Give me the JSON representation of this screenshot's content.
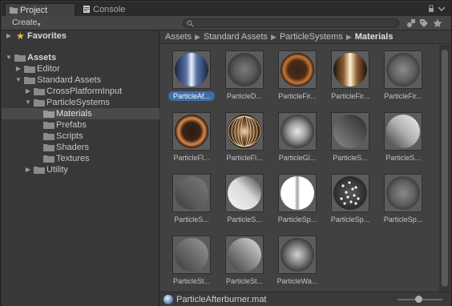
{
  "tabs": [
    {
      "label": "Project",
      "icon": "project-icon",
      "active": true
    },
    {
      "label": "Console",
      "icon": "console-icon",
      "active": false
    }
  ],
  "toolbar": {
    "create_label": "Create",
    "search_value": ""
  },
  "tree": {
    "favorites": "Favorites",
    "assets": "Assets",
    "editor": "Editor",
    "standard_assets": "Standard Assets",
    "cross_platform_input": "CrossPlatformInput",
    "particle_systems": "ParticleSystems",
    "materials": "Materials",
    "prefabs": "Prefabs",
    "scripts": "Scripts",
    "shaders": "Shaders",
    "textures": "Textures",
    "utility": "Utility"
  },
  "breadcrumb": [
    "Assets",
    "Standard Assets",
    "ParticleSystems",
    "Materials"
  ],
  "materials": [
    {
      "name": "ParticleAf...",
      "style": "afterburner",
      "selected": true
    },
    {
      "name": "ParticleD...",
      "style": "dust"
    },
    {
      "name": "ParticleFir...",
      "style": "fire-ring"
    },
    {
      "name": "ParticleFir...",
      "style": "fire-flame"
    },
    {
      "name": "ParticleFir...",
      "style": "soft-gray"
    },
    {
      "name": "ParticleFl...",
      "style": "flare-ring"
    },
    {
      "name": "ParticleFl...",
      "style": "flare-cage"
    },
    {
      "name": "ParticleGl...",
      "style": "glow"
    },
    {
      "name": "ParticleS...",
      "style": "smoke-dark"
    },
    {
      "name": "ParticleS...",
      "style": "smoke-bright"
    },
    {
      "name": "ParticleS...",
      "style": "smoke-dim"
    },
    {
      "name": "ParticleS...",
      "style": "smoke-white"
    },
    {
      "name": "ParticleSp...",
      "style": "spark-streak"
    },
    {
      "name": "ParticleSp...",
      "style": "sparkle"
    },
    {
      "name": "ParticleSp...",
      "style": "soft-gray"
    },
    {
      "name": "ParticleSt...",
      "style": "steam-dim"
    },
    {
      "name": "ParticleSt...",
      "style": "steam-bright"
    },
    {
      "name": "ParticleWa...",
      "style": "water"
    }
  ],
  "status": {
    "filename": "ParticleAfterburner.mat"
  },
  "colors": {
    "selection": "#3d6ea8",
    "favorite_star": "#f0c030"
  }
}
